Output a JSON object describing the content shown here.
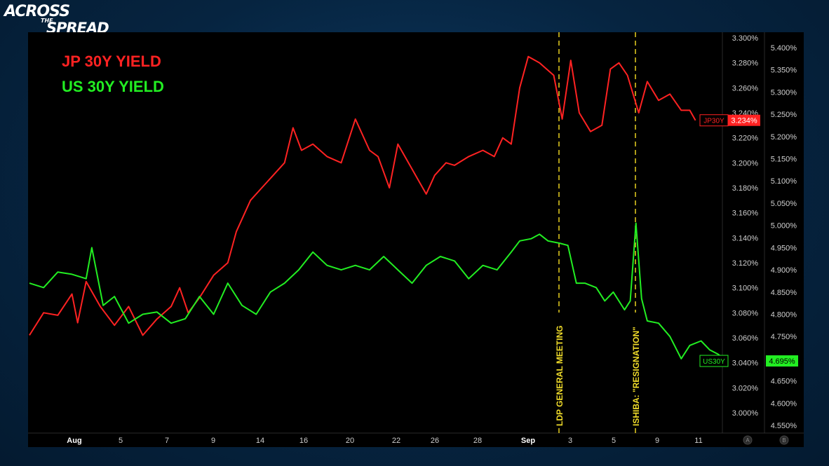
{
  "logo": {
    "line1": "ACROSS",
    "line2": "THE",
    "line3": "SPREAD"
  },
  "legend": [
    {
      "label": "JP 30Y YIELD",
      "color": "#ff2222"
    },
    {
      "label": "US 30Y YIELD",
      "color": "#22ee22"
    }
  ],
  "chart_data": {
    "type": "line",
    "x_labels": [
      "Aug",
      "5",
      "7",
      "9",
      "14",
      "16",
      "20",
      "22",
      "26",
      "28",
      "Sep",
      "3",
      "5",
      "9",
      "11"
    ],
    "left_axis": {
      "series": "JP30Y",
      "ticks": [
        "3.300%",
        "3.280%",
        "3.260%",
        "3.240%",
        "3.220%",
        "3.200%",
        "3.180%",
        "3.160%",
        "3.140%",
        "3.120%",
        "3.100%",
        "3.080%",
        "3.060%",
        "3.040%",
        "3.020%",
        "3.000%"
      ],
      "range": [
        3.0,
        3.3
      ],
      "label": "A"
    },
    "right_axis": {
      "series": "US30Y",
      "ticks": [
        "5.400%",
        "5.350%",
        "5.300%",
        "5.250%",
        "5.200%",
        "5.150%",
        "5.100%",
        "5.050%",
        "5.000%",
        "4.950%",
        "4.900%",
        "4.850%",
        "4.800%",
        "4.750%",
        "4.700%",
        "4.650%",
        "4.600%",
        "4.550%"
      ],
      "range": [
        4.55,
        5.4
      ],
      "label": "B"
    },
    "series": [
      {
        "name": "JP30Y",
        "color": "#ff2222",
        "last_label": "3.234%",
        "points": [
          [
            0,
            3.062
          ],
          [
            0.5,
            3.08
          ],
          [
            1,
            3.078
          ],
          [
            1.5,
            3.095
          ],
          [
            1.7,
            3.072
          ],
          [
            2,
            3.105
          ],
          [
            2.5,
            3.085
          ],
          [
            3,
            3.07
          ],
          [
            3.5,
            3.085
          ],
          [
            4,
            3.062
          ],
          [
            4.5,
            3.075
          ],
          [
            5,
            3.085
          ],
          [
            5.3,
            3.1
          ],
          [
            5.6,
            3.08
          ],
          [
            6,
            3.092
          ],
          [
            6.5,
            3.11
          ],
          [
            7,
            3.12
          ],
          [
            7.3,
            3.145
          ],
          [
            7.8,
            3.17
          ],
          [
            8.2,
            3.18
          ],
          [
            8.6,
            3.19
          ],
          [
            9,
            3.2
          ],
          [
            9.3,
            3.228
          ],
          [
            9.6,
            3.21
          ],
          [
            10,
            3.215
          ],
          [
            10.5,
            3.205
          ],
          [
            11,
            3.2
          ],
          [
            11.5,
            3.235
          ],
          [
            12,
            3.21
          ],
          [
            12.3,
            3.205
          ],
          [
            12.7,
            3.18
          ],
          [
            13,
            3.215
          ],
          [
            13.5,
            3.195
          ],
          [
            14,
            3.175
          ],
          [
            14.3,
            3.19
          ],
          [
            14.7,
            3.2
          ],
          [
            15,
            3.198
          ],
          [
            15.5,
            3.205
          ],
          [
            16,
            3.21
          ],
          [
            16.4,
            3.205
          ],
          [
            16.7,
            3.22
          ],
          [
            17,
            3.215
          ],
          [
            17.3,
            3.26
          ],
          [
            17.6,
            3.285
          ],
          [
            18,
            3.28
          ],
          [
            18.5,
            3.27
          ],
          [
            18.8,
            3.235
          ],
          [
            19.1,
            3.282
          ],
          [
            19.4,
            3.24
          ],
          [
            19.8,
            3.225
          ],
          [
            20.2,
            3.23
          ],
          [
            20.5,
            3.275
          ],
          [
            20.8,
            3.28
          ],
          [
            21.1,
            3.27
          ],
          [
            21.5,
            3.24
          ],
          [
            21.8,
            3.265
          ],
          [
            22.2,
            3.25
          ],
          [
            22.6,
            3.255
          ],
          [
            23,
            3.242
          ],
          [
            23.3,
            3.242
          ],
          [
            23.5,
            3.234
          ]
        ]
      },
      {
        "name": "US30Y",
        "color": "#22ee22",
        "last_label": "4.695%",
        "points": [
          [
            0,
            4.87
          ],
          [
            0.5,
            4.86
          ],
          [
            1,
            4.895
          ],
          [
            1.5,
            4.89
          ],
          [
            2,
            4.88
          ],
          [
            2.2,
            4.95
          ],
          [
            2.6,
            4.82
          ],
          [
            3,
            4.84
          ],
          [
            3.5,
            4.78
          ],
          [
            4,
            4.8
          ],
          [
            4.5,
            4.805
          ],
          [
            5,
            4.78
          ],
          [
            5.5,
            4.79
          ],
          [
            6,
            4.84
          ],
          [
            6.5,
            4.8
          ],
          [
            7,
            4.87
          ],
          [
            7.5,
            4.82
          ],
          [
            8,
            4.8
          ],
          [
            8.5,
            4.85
          ],
          [
            9,
            4.87
          ],
          [
            9.5,
            4.9
          ],
          [
            10,
            4.94
          ],
          [
            10.5,
            4.91
          ],
          [
            11,
            4.9
          ],
          [
            11.5,
            4.91
          ],
          [
            12,
            4.9
          ],
          [
            12.5,
            4.93
          ],
          [
            13,
            4.9
          ],
          [
            13.5,
            4.87
          ],
          [
            14,
            4.91
          ],
          [
            14.5,
            4.93
          ],
          [
            15,
            4.92
          ],
          [
            15.5,
            4.88
          ],
          [
            16,
            4.91
          ],
          [
            16.5,
            4.9
          ],
          [
            17,
            4.94
          ],
          [
            17.3,
            4.965
          ],
          [
            17.7,
            4.97
          ],
          [
            18,
            4.98
          ],
          [
            18.3,
            4.965
          ],
          [
            18.7,
            4.96
          ],
          [
            19,
            4.955
          ],
          [
            19.3,
            4.87
          ],
          [
            19.6,
            4.87
          ],
          [
            20,
            4.86
          ],
          [
            20.3,
            4.83
          ],
          [
            20.6,
            4.85
          ],
          [
            21,
            4.81
          ],
          [
            21.2,
            4.83
          ],
          [
            21.4,
            5.005
          ],
          [
            21.6,
            4.835
          ],
          [
            21.8,
            4.785
          ],
          [
            22.2,
            4.78
          ],
          [
            22.6,
            4.75
          ],
          [
            23,
            4.7
          ],
          [
            23.3,
            4.73
          ],
          [
            23.7,
            4.74
          ],
          [
            24,
            4.72
          ],
          [
            24.3,
            4.71
          ],
          [
            24.6,
            4.695
          ]
        ]
      }
    ],
    "annotations": [
      {
        "label": "LDP GENERAL MEETING"
      },
      {
        "label": "ISHIBA: \"RESIGNATION\""
      }
    ]
  }
}
